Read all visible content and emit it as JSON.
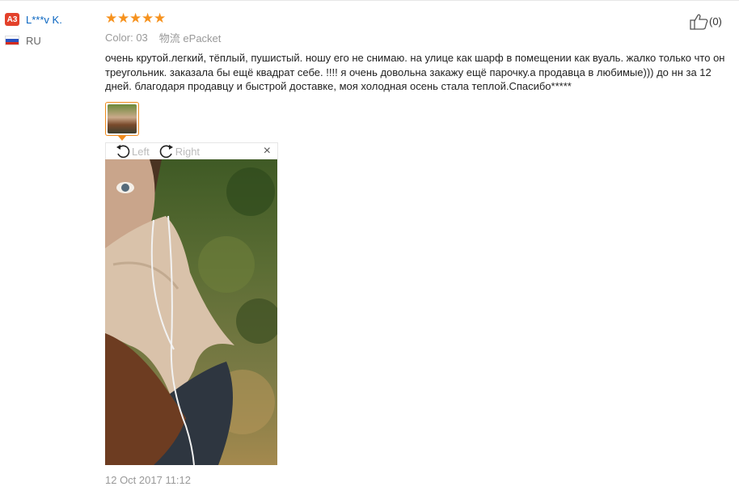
{
  "user": {
    "badge": "A3",
    "name": "L***v K.",
    "country": "RU"
  },
  "review": {
    "rating_stars": 5,
    "color_label": "Color:",
    "color_value": "03",
    "shipping_label": "物流",
    "shipping_value": "ePacket",
    "text": "очень крутой.легкий, тёплый, пушистый. ношу его не снимаю. на улице как шарф в помещении как вуаль. жалко только что он треугольник. заказала бы ещё квадрат себе. !!!! я очень довольна закажу ещё парочку.а продавца в любимые))) до нн за 12 дней. благодаря продавцу и быстрой доставке, моя холодная осень стала теплой.Спасибо*****",
    "date": "12 Oct 2017 11:12"
  },
  "viewer": {
    "rotate_left_label": "Left",
    "rotate_right_label": "Right",
    "close_glyph": "×"
  },
  "helpful": {
    "count": "(0)"
  },
  "colors": {
    "accent_orange": "#f08b1c",
    "star_orange": "#f6921e",
    "badge_red": "#e3412b",
    "link_blue": "#0b66c1"
  },
  "icons": {
    "badge": "level-badge-icon",
    "flag": "russia-flag-icon",
    "rotate_left": "rotate-left-icon",
    "rotate_right": "rotate-right-icon",
    "close": "close-icon",
    "thumbs_up": "thumbs-up-icon"
  }
}
